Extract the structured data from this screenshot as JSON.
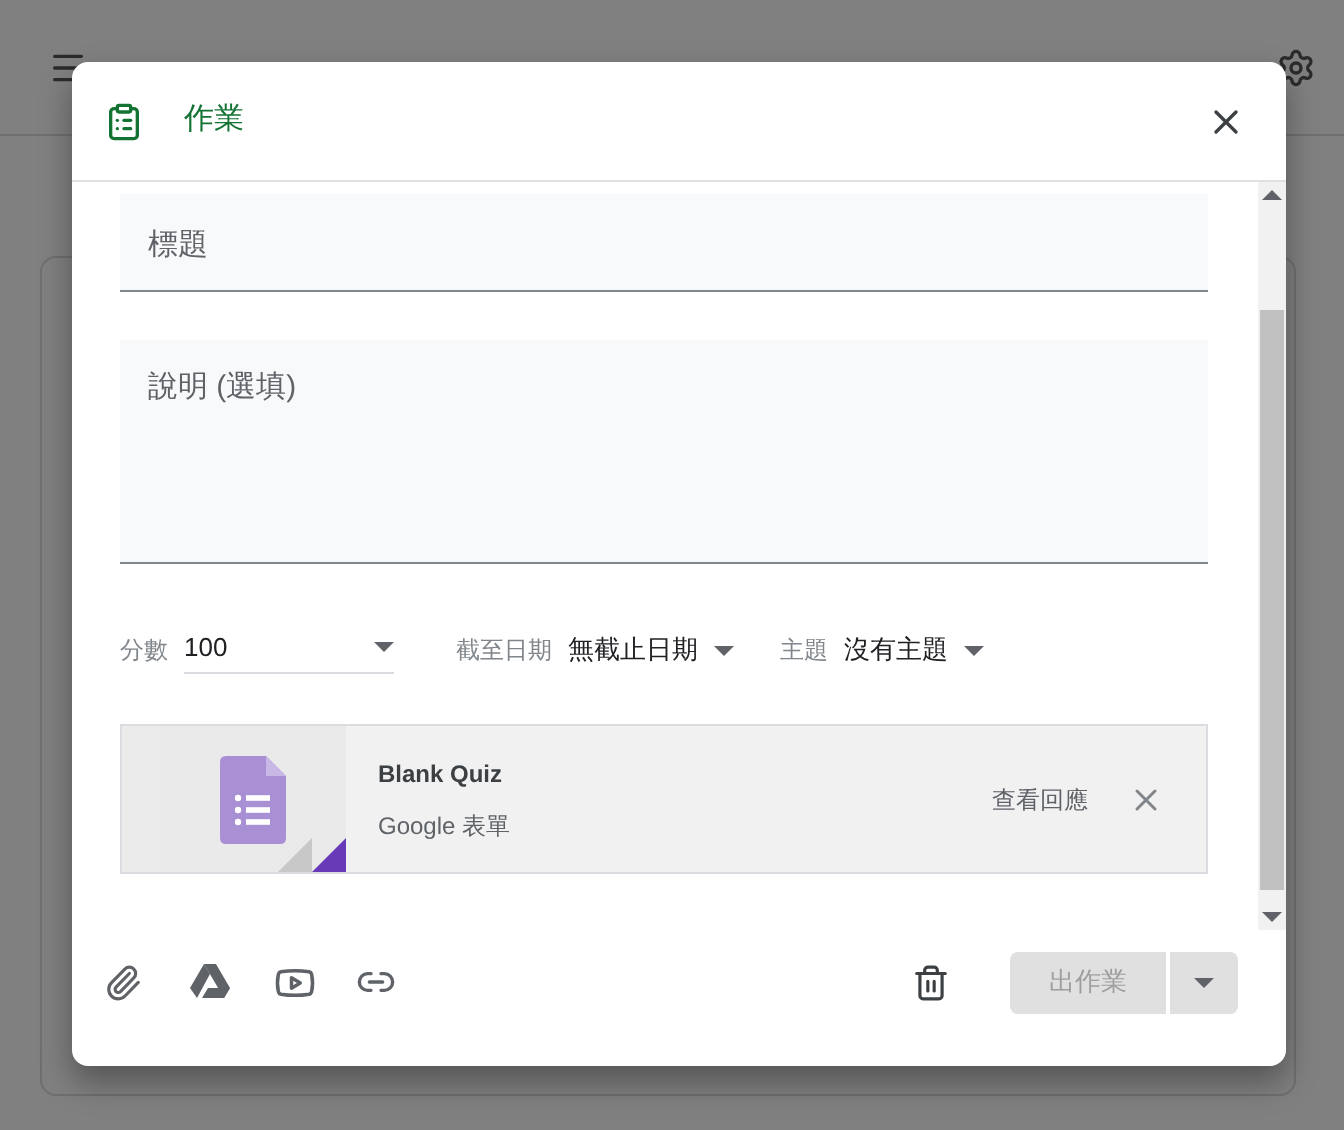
{
  "dialog": {
    "title": "作業"
  },
  "fields": [
    {
      "kind": "title",
      "placeholder": "標題"
    },
    {
      "kind": "description",
      "placeholder": "說明 (選填)"
    }
  ],
  "settings": [
    {
      "label": "分數",
      "value": "100",
      "kind": "underlined"
    },
    {
      "label": "截至日期",
      "value": "無截止日期",
      "kind": "plain"
    },
    {
      "label": "主題",
      "value": "沒有主題",
      "kind": "plain"
    }
  ],
  "attachment": {
    "title": "Blank Quiz",
    "subtitle": "Google 表單",
    "action": "查看回應"
  },
  "footer": {
    "assign_button": {
      "label": "出作業",
      "disabled": true
    }
  }
}
